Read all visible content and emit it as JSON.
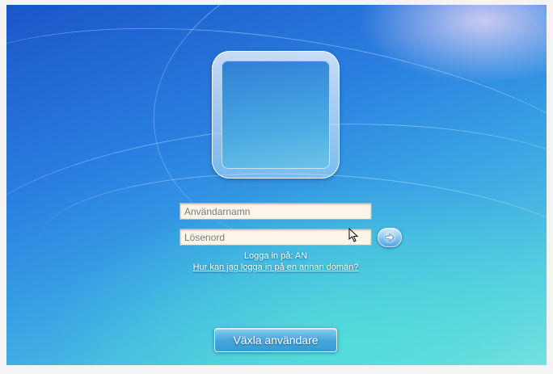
{
  "login": {
    "username_placeholder": "Användarnamn",
    "password_placeholder": "Lösenord",
    "logon_domain_text": "Logga in på: AN",
    "other_domain_link": "Hur kan jag logga in på en annan domän?",
    "switch_user_label": "Växla användare"
  },
  "icons": {
    "submit": "arrow-right-icon",
    "cursor": "mouse-pointer-icon"
  },
  "colors": {
    "background_top": "#1a56c8",
    "background_bottom": "#7fe0e4",
    "field_background": "#fdf6e8",
    "button_blue": "#4f9fe0"
  }
}
